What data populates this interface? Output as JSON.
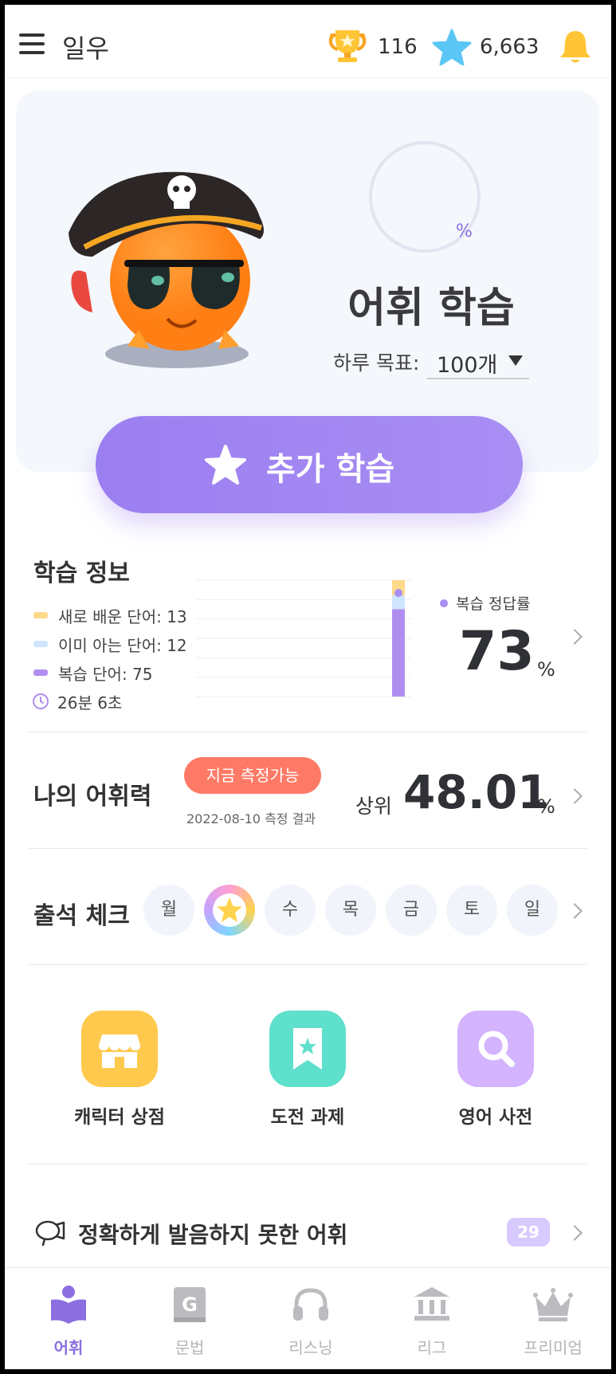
{
  "header": {
    "title": "일우",
    "trophy_count": "116",
    "star_count": "6,663"
  },
  "hero": {
    "progress_unit": "%",
    "title": "어휘 학습",
    "goal_label": "하루 목표:",
    "goal_value": "100개",
    "cta_label": "추가 학습"
  },
  "study_info": {
    "title": "학습 정보",
    "legend": [
      {
        "label": "새로 배운 단어: 13",
        "color": "#ffd98a"
      },
      {
        "label": "이미 아는 단어: 12",
        "color": "#cfe4ff"
      },
      {
        "label": "복습 단어: 75",
        "color": "#b08ef0"
      }
    ],
    "time": "26분 6초",
    "accuracy_label": "복습 정답률",
    "accuracy_value": "73",
    "accuracy_unit": "%",
    "chart_data": {
      "type": "bar",
      "categories": [
        ""
      ],
      "series": [
        {
          "name": "복습 단어",
          "values": [
            75
          ],
          "color": "#b08ef0"
        },
        {
          "name": "이미 아는 단어",
          "values": [
            12
          ],
          "color": "#cfe4ff"
        },
        {
          "name": "새로 배운 단어",
          "values": [
            13
          ],
          "color": "#ffd98a"
        }
      ],
      "stacked": true,
      "ylim": [
        0,
        100
      ],
      "grid": true,
      "marker_value": 73
    }
  },
  "vocab": {
    "title": "나의 어휘력",
    "badge": "지금 측정가능",
    "date": "2022-08-10 측정 결과",
    "rank_label": "상위",
    "rank_value": "48.01",
    "rank_unit": "%"
  },
  "attendance": {
    "title": "출석 체크",
    "days": [
      {
        "label": "월",
        "done": false
      },
      {
        "label": "화",
        "done": true
      },
      {
        "label": "수",
        "done": false
      },
      {
        "label": "목",
        "done": false
      },
      {
        "label": "금",
        "done": false
      },
      {
        "label": "토",
        "done": false
      },
      {
        "label": "일",
        "done": false
      }
    ]
  },
  "shortcuts": [
    {
      "label": "캐릭터 상점",
      "icon": "store-icon",
      "color": "#ffc94d"
    },
    {
      "label": "도전 과제",
      "icon": "bookmark-star-icon",
      "color": "#5fe0cc"
    },
    {
      "label": "영어 사전",
      "icon": "search-icon",
      "color": "#d4b3ff"
    }
  ],
  "pronunciation": {
    "label": "정확하게 발음하지 못한 어휘",
    "count": "29"
  },
  "bottom_nav": [
    {
      "label": "어휘",
      "icon": "book-person-icon",
      "active": true
    },
    {
      "label": "문법",
      "icon": "grammar-book-icon",
      "active": false
    },
    {
      "label": "리스닝",
      "icon": "headphones-icon",
      "active": false
    },
    {
      "label": "리그",
      "icon": "institution-icon",
      "active": false
    },
    {
      "label": "프리미엄",
      "icon": "crown-icon",
      "active": false
    }
  ]
}
